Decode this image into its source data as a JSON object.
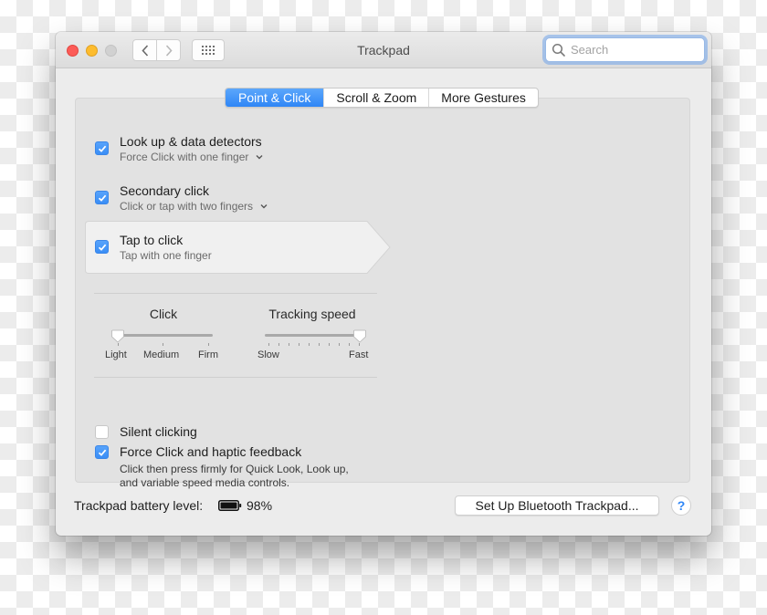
{
  "window": {
    "title": "Trackpad",
    "search": {
      "placeholder": "Search",
      "value": ""
    }
  },
  "toolbar": {
    "back_label": "‹",
    "forward_label": "›"
  },
  "tabs": [
    {
      "label": "Point & Click",
      "active": true
    },
    {
      "label": "Scroll & Zoom",
      "active": false
    },
    {
      "label": "More Gestures",
      "active": false
    }
  ],
  "options": [
    {
      "title": "Look up & data detectors",
      "subtitle": "Force Click with one finger",
      "checked": true,
      "has_dropdown": true
    },
    {
      "title": "Secondary click",
      "subtitle": "Click or tap with two fingers",
      "checked": true,
      "has_dropdown": true
    },
    {
      "title": "Tap to click",
      "subtitle": "Tap with one finger",
      "checked": true,
      "has_dropdown": false,
      "selected": true
    }
  ],
  "sliders": {
    "click": {
      "title": "Click",
      "labels": [
        "Light",
        "Medium",
        "Firm"
      ],
      "value_index": 0,
      "steps": 3
    },
    "tracking": {
      "title": "Tracking speed",
      "min_label": "Slow",
      "max_label": "Fast",
      "value_index": 9,
      "steps": 10
    }
  },
  "bottom_options": [
    {
      "title": "Silent clicking",
      "checked": false
    },
    {
      "title": "Force Click and haptic feedback",
      "checked": true,
      "description_line1": "Click then press firmly for Quick Look, Look up,",
      "description_line2": "and variable speed media controls."
    }
  ],
  "footer": {
    "battery_label": "Trackpad battery level:",
    "battery_percent": "98%",
    "setup_button": "Set Up Bluetooth Trackpad...",
    "help_label": "?"
  },
  "colors": {
    "accent": "#3a8ef6",
    "close": "#fc5b57",
    "minimize": "#fdbc2e",
    "zoom_disabled": "#d1d1d1"
  }
}
